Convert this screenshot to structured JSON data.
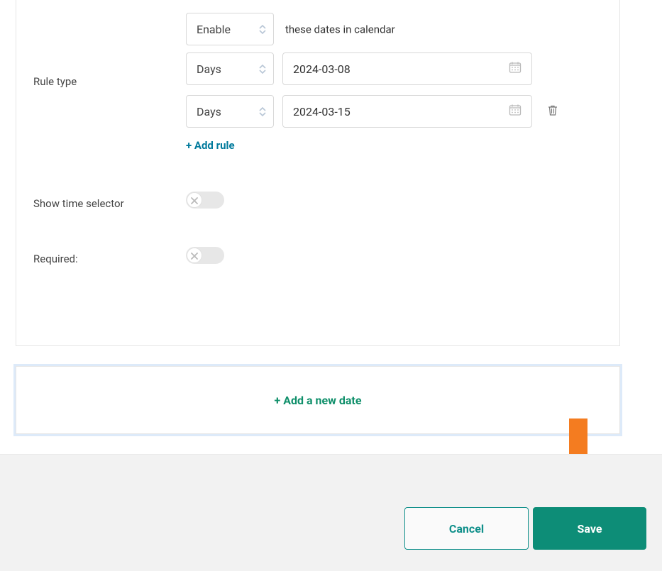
{
  "rule": {
    "label": "Rule type",
    "mode_select": "Enable",
    "mode_suffix": "these dates in calendar",
    "rows": [
      {
        "unit": "Days",
        "date": "2024-03-08",
        "deletable": false
      },
      {
        "unit": "Days",
        "date": "2024-03-15",
        "deletable": true
      }
    ],
    "add_label": "+ Add rule"
  },
  "show_time": {
    "label": "Show time selector",
    "value": false
  },
  "required": {
    "label": "Required:",
    "value": false
  },
  "add_new_date": {
    "label": "+ Add a new date"
  },
  "footer": {
    "cancel": "Cancel",
    "save": "Save"
  },
  "icons": {
    "chevron": "chevron",
    "calendar": "calendar",
    "trash": "trash",
    "x": "x",
    "arrow": "arrow-down"
  }
}
